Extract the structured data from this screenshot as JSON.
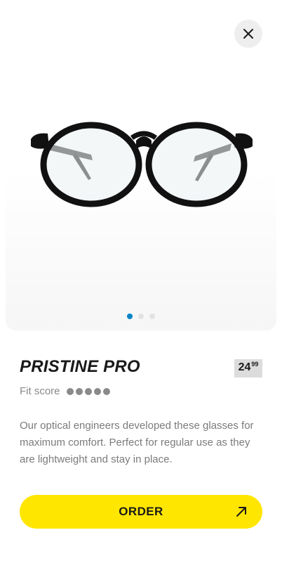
{
  "product": {
    "name": "PRISTINE PRO",
    "price_whole": "24",
    "price_cents": "99",
    "fit_label": "Fit score",
    "fit_score": 5,
    "fit_max": 5,
    "description": "Our optical engineers developed these glasses for maximum comfort. Perfect for regular use as they are lightweight and stay in place."
  },
  "gallery": {
    "image": "round-eyeglasses",
    "slide_count": 3,
    "active_slide": 1
  },
  "actions": {
    "close_icon": "close-icon",
    "order_label": "ORDER",
    "order_icon": "arrow-up-right-icon"
  },
  "colors": {
    "accent_yellow": "#ffe600",
    "active_dot": "#0a84c9",
    "price_badge": "#dcdcdc"
  }
}
